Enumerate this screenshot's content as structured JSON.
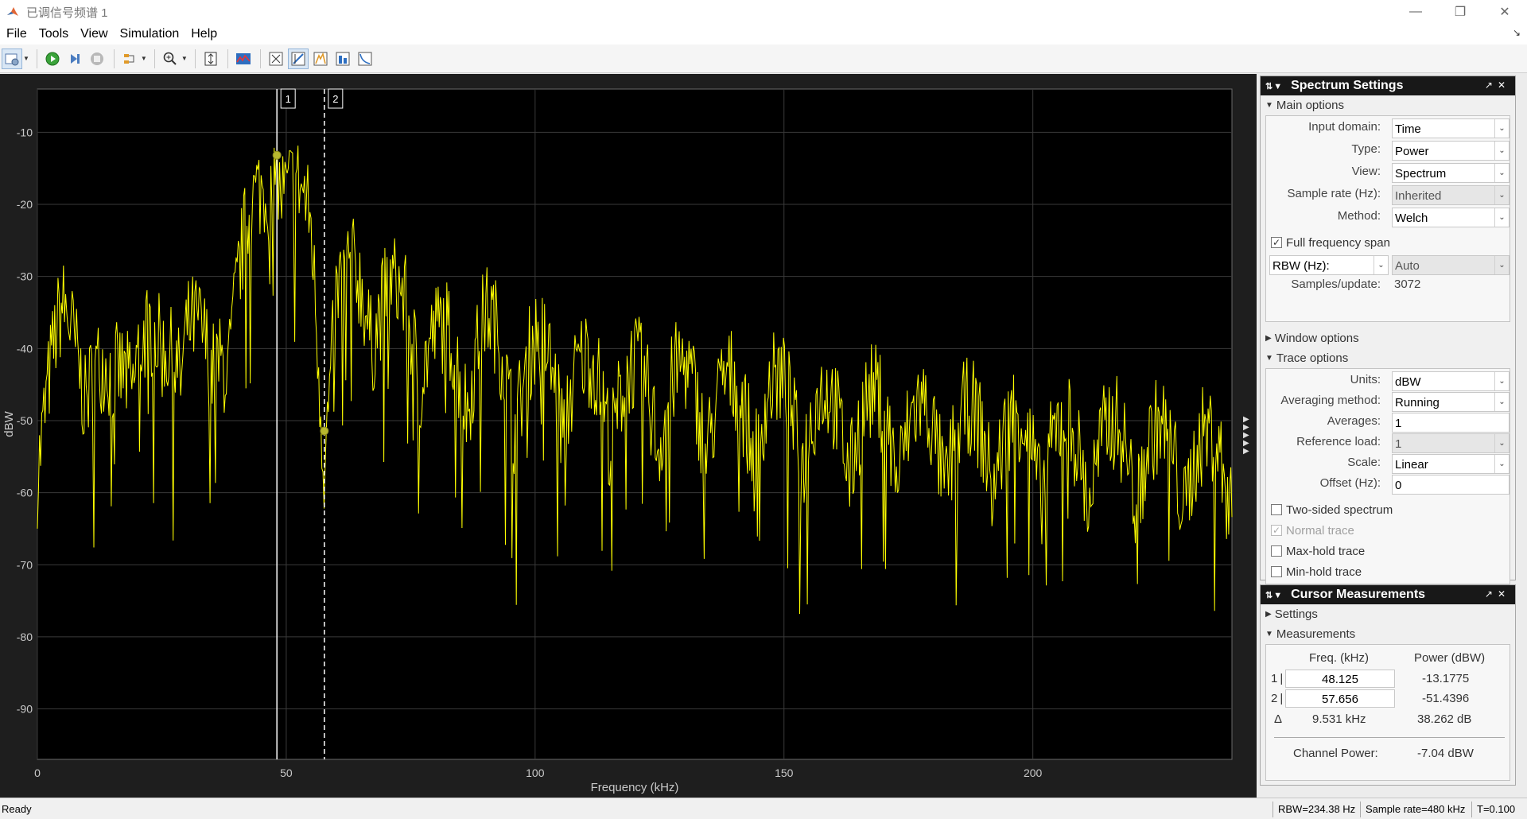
{
  "window": {
    "title": "已调信号频谱 1",
    "icon": "matlab-logo-icon",
    "controls": [
      "minimize-icon",
      "restore-icon",
      "close-icon"
    ]
  },
  "menu": [
    "File",
    "Tools",
    "View",
    "Simulation",
    "Help"
  ],
  "toolbar": {
    "icons": [
      "settings-icon",
      "run-icon",
      "step-forward-icon",
      "stop-icon",
      "highlight-signal-icon",
      "zoom-in-icon",
      "scale-axes-icon",
      "spectrum-icon",
      "cursor-measurements-icon",
      "peak-finder-icon",
      "channel-measurements-icon",
      "distortion-measurements-icon",
      "ccdf-icon"
    ]
  },
  "colors": {
    "plot_bg": "#000000",
    "frame_bg": "#1e1e1e",
    "trace": "#ffff00",
    "marker": "#b8b82e",
    "grid": "#3a3a3a",
    "axis_text": "#c8c8c8"
  },
  "chart_data": {
    "type": "line",
    "title": "",
    "xlabel": "Frequency (kHz)",
    "ylabel": "dBW",
    "xlim": [
      0,
      240
    ],
    "ylim": [
      -97,
      -4
    ],
    "xticks": [
      0,
      50,
      100,
      150,
      200
    ],
    "yticks": [
      -10,
      -20,
      -30,
      -40,
      -50,
      -60,
      -70,
      -80,
      -90
    ],
    "grid": true,
    "series": [
      {
        "description": "power spectrum envelope (approximate)",
        "x": [
          0,
          5,
          10,
          15,
          20,
          25,
          30,
          35,
          40,
          45,
          48.125,
          50,
          55,
          57.656,
          60,
          65,
          70,
          75,
          80,
          85,
          90,
          95,
          100,
          110,
          120,
          130,
          140,
          150,
          160,
          170,
          180,
          190,
          200,
          210,
          220,
          230,
          240
        ],
        "values": [
          -52,
          -40,
          -42,
          -50,
          -38,
          -46,
          -36,
          -48,
          -32,
          -22,
          -13.1775,
          -20,
          -26,
          -51.4396,
          -36,
          -33,
          -36,
          -38,
          -42,
          -44,
          -40,
          -46,
          -44,
          -47,
          -48,
          -48,
          -50,
          -50,
          -52,
          -52,
          -54,
          -54,
          -55,
          -56,
          -56,
          -57,
          -58
        ]
      }
    ],
    "cursors": [
      {
        "label": "1",
        "freq_khz": 48.125,
        "power_dbw": -13.1775,
        "style": "solid"
      },
      {
        "label": "2",
        "freq_khz": 57.656,
        "power_dbw": -51.4396,
        "style": "dashed"
      }
    ]
  },
  "spectrum_settings": {
    "header": "Spectrum Settings",
    "main_options_title": "Main options",
    "main_options": [
      {
        "label": "Input domain:",
        "value": "Time",
        "dropdown": true,
        "enabled": true
      },
      {
        "label": "Type:",
        "value": "Power",
        "dropdown": true,
        "enabled": true
      },
      {
        "label": "View:",
        "value": "Spectrum",
        "dropdown": true,
        "enabled": true
      },
      {
        "label": "Sample rate (Hz):",
        "value": "Inherited",
        "dropdown": true,
        "enabled": false
      },
      {
        "label": "Method:",
        "value": "Welch",
        "dropdown": true,
        "enabled": true
      }
    ],
    "full_frequency_span": {
      "label": "Full frequency span",
      "checked": true
    },
    "rbw": {
      "label": "RBW (Hz):",
      "value": "Auto"
    },
    "samples_per_update": {
      "label": "Samples/update:",
      "value": "3072"
    },
    "window_options_title": "Window options",
    "trace_options_title": "Trace options",
    "trace_options": [
      {
        "label": "Units:",
        "value": "dBW",
        "dropdown": true,
        "enabled": true
      },
      {
        "label": "Averaging method:",
        "value": "Running",
        "dropdown": true,
        "enabled": true
      },
      {
        "label": "Averages:",
        "value": "1",
        "dropdown": false,
        "enabled": true
      },
      {
        "label": "Reference load:",
        "value": "1",
        "dropdown": true,
        "enabled": false
      },
      {
        "label": "Scale:",
        "value": "Linear",
        "dropdown": true,
        "enabled": true
      },
      {
        "label": "Offset (Hz):",
        "value": "0",
        "dropdown": false,
        "enabled": true
      }
    ],
    "trace_checks": [
      {
        "label": "Two-sided spectrum",
        "checked": false,
        "enabled": true
      },
      {
        "label": "Normal trace",
        "checked": true,
        "enabled": false
      },
      {
        "label": "Max-hold trace",
        "checked": false,
        "enabled": true
      },
      {
        "label": "Min-hold trace",
        "checked": false,
        "enabled": true
      }
    ]
  },
  "cursor_measurements": {
    "header": "Cursor Measurements",
    "settings_title": "Settings",
    "measurements_title": "Measurements",
    "col_freq": "Freq. (kHz)",
    "col_power": "Power (dBW)",
    "rows": [
      {
        "label": "1",
        "freq": "48.125",
        "power": "-13.1775"
      },
      {
        "label": "2",
        "freq": "57.656",
        "power": "-51.4396"
      }
    ],
    "delta": {
      "label": "Δ",
      "freq": "9.531 kHz",
      "power": "38.262 dB"
    },
    "channel_power": {
      "label": "Channel Power:",
      "value": "-7.04 dBW"
    }
  },
  "status": {
    "ready": "Ready",
    "rbw": "RBW=234.38 Hz",
    "sample_rate": "Sample rate=480 kHz",
    "time": "T=0.100"
  }
}
